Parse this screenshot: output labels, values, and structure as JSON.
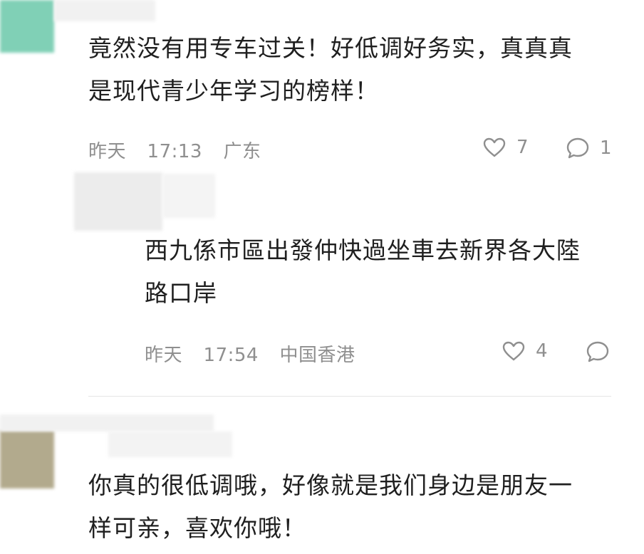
{
  "comments": [
    {
      "text_lines": [
        "竟然没有用专车过关！好低调好务实，真真真",
        "是现代青少年学习的榜样！"
      ],
      "date": "昨天",
      "time": "17:13",
      "location": "广东",
      "likes": "7",
      "replies": "1"
    },
    {
      "text_lines": [
        "西九係市區出發仲快過坐車去新界各大陸",
        "路口岸"
      ],
      "date": "昨天",
      "time": "17:54",
      "location": "中国香港",
      "likes": "4",
      "replies": ""
    },
    {
      "text_lines": [
        "你真的很低调哦，好像就是我们身边是朋友一",
        "样可亲，喜欢你哦！"
      ]
    }
  ],
  "icons": {
    "like": "heart-outline-icon",
    "reply": "speech-bubble-icon"
  },
  "colors": {
    "text": "#1f1f1f",
    "meta": "#8f8f8f",
    "avatar_blur_1": "#7dcfb3",
    "avatar_blur_3": "#b3ab8e"
  }
}
